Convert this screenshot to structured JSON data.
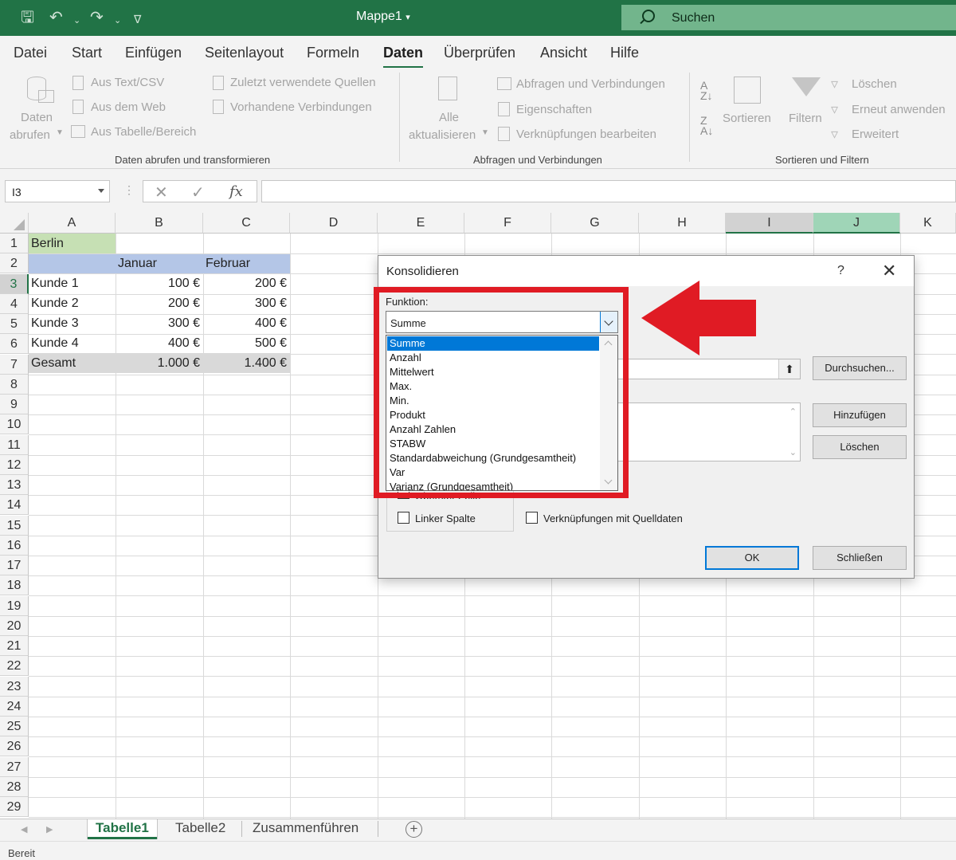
{
  "window": {
    "title": "Mappe1",
    "search_placeholder": "Suchen"
  },
  "menu": {
    "tabs": [
      "Datei",
      "Start",
      "Einfügen",
      "Seitenlayout",
      "Formeln",
      "Daten",
      "Überprüfen",
      "Ansicht",
      "Hilfe"
    ],
    "active_tab": "Daten"
  },
  "ribbon": {
    "daten_abrufen_1": "Daten",
    "daten_abrufen_2": "abrufen",
    "aus_text_csv": "Aus Text/CSV",
    "aus_dem_web": "Aus dem Web",
    "aus_tabelle": "Aus Tabelle/Bereich",
    "zuletzt_quellen": "Zuletzt verwendete Quellen",
    "vorhandene_verbindungen": "Vorhandene Verbindungen",
    "group_transform": "Daten abrufen und transformieren",
    "alle_1": "Alle",
    "alle_2": "aktualisieren",
    "abfragen_verbindungen": "Abfragen und Verbindungen",
    "eigenschaften": "Eigenschaften",
    "verknuepfungen_bearbeiten": "Verknüpfungen bearbeiten",
    "group_abfragen": "Abfragen und Verbindungen",
    "sortieren": "Sortieren",
    "filtern": "Filtern",
    "loeschen": "Löschen",
    "erneut_anwenden": "Erneut anwenden",
    "erweitert": "Erweitert",
    "group_sortieren": "Sortieren und Filtern"
  },
  "formula_bar": {
    "name_box": "I3",
    "fx": "fx",
    "formula": ""
  },
  "grid": {
    "columns": [
      "A",
      "B",
      "C",
      "D",
      "E",
      "F",
      "G",
      "H",
      "I",
      "J",
      "K"
    ],
    "rows": [
      "1",
      "2",
      "3",
      "4",
      "5",
      "6",
      "7",
      "8",
      "9",
      "10",
      "11",
      "12",
      "13",
      "14",
      "15",
      "16",
      "17",
      "18",
      "19",
      "20",
      "21",
      "22",
      "23",
      "24",
      "25",
      "26",
      "27",
      "28",
      "29"
    ],
    "cells": {
      "a1": "Berlin",
      "b2": "Januar",
      "c2": "Februar",
      "a3": "Kunde 1",
      "b3": "100 €",
      "c3": "200 €",
      "a4": "Kunde 2",
      "b4": "200 €",
      "c4": "300 €",
      "a5": "Kunde 3",
      "b5": "300 €",
      "c5": "400 €",
      "a6": "Kunde 4",
      "b6": "400 €",
      "c6": "500 €",
      "a7": "Gesamt",
      "b7": "1.000 €",
      "c7": "1.400 €"
    }
  },
  "sheets": {
    "tabs": [
      "Tabelle1",
      "Tabelle2",
      "Zusammenführen"
    ],
    "active": "Tabelle1"
  },
  "status": {
    "text": "Bereit"
  },
  "dialog": {
    "title": "Konsolidieren",
    "help": "?",
    "close": "✕",
    "funktion_label": "Funktion:",
    "funktion_value": "Summe",
    "options": [
      "Summe",
      "Anzahl",
      "Mittelwert",
      "Max.",
      "Min.",
      "Produkt",
      "Anzahl Zahlen",
      "STABW",
      "Standardabweichung (Grundgesamtheit)",
      "Var",
      "Varianz (Grundgesamtheit)"
    ],
    "durchsuchen": "Durchsuchen...",
    "hinzufuegen": "Hinzufügen",
    "loeschen": "Löschen",
    "oberster_zeile": "Oberster Zeile",
    "linker_spalte": "Linker Spalte",
    "verknuepfungen_quelldaten": "Verknüpfungen mit Quelldaten",
    "ok": "OK",
    "schliessen": "Schließen"
  }
}
